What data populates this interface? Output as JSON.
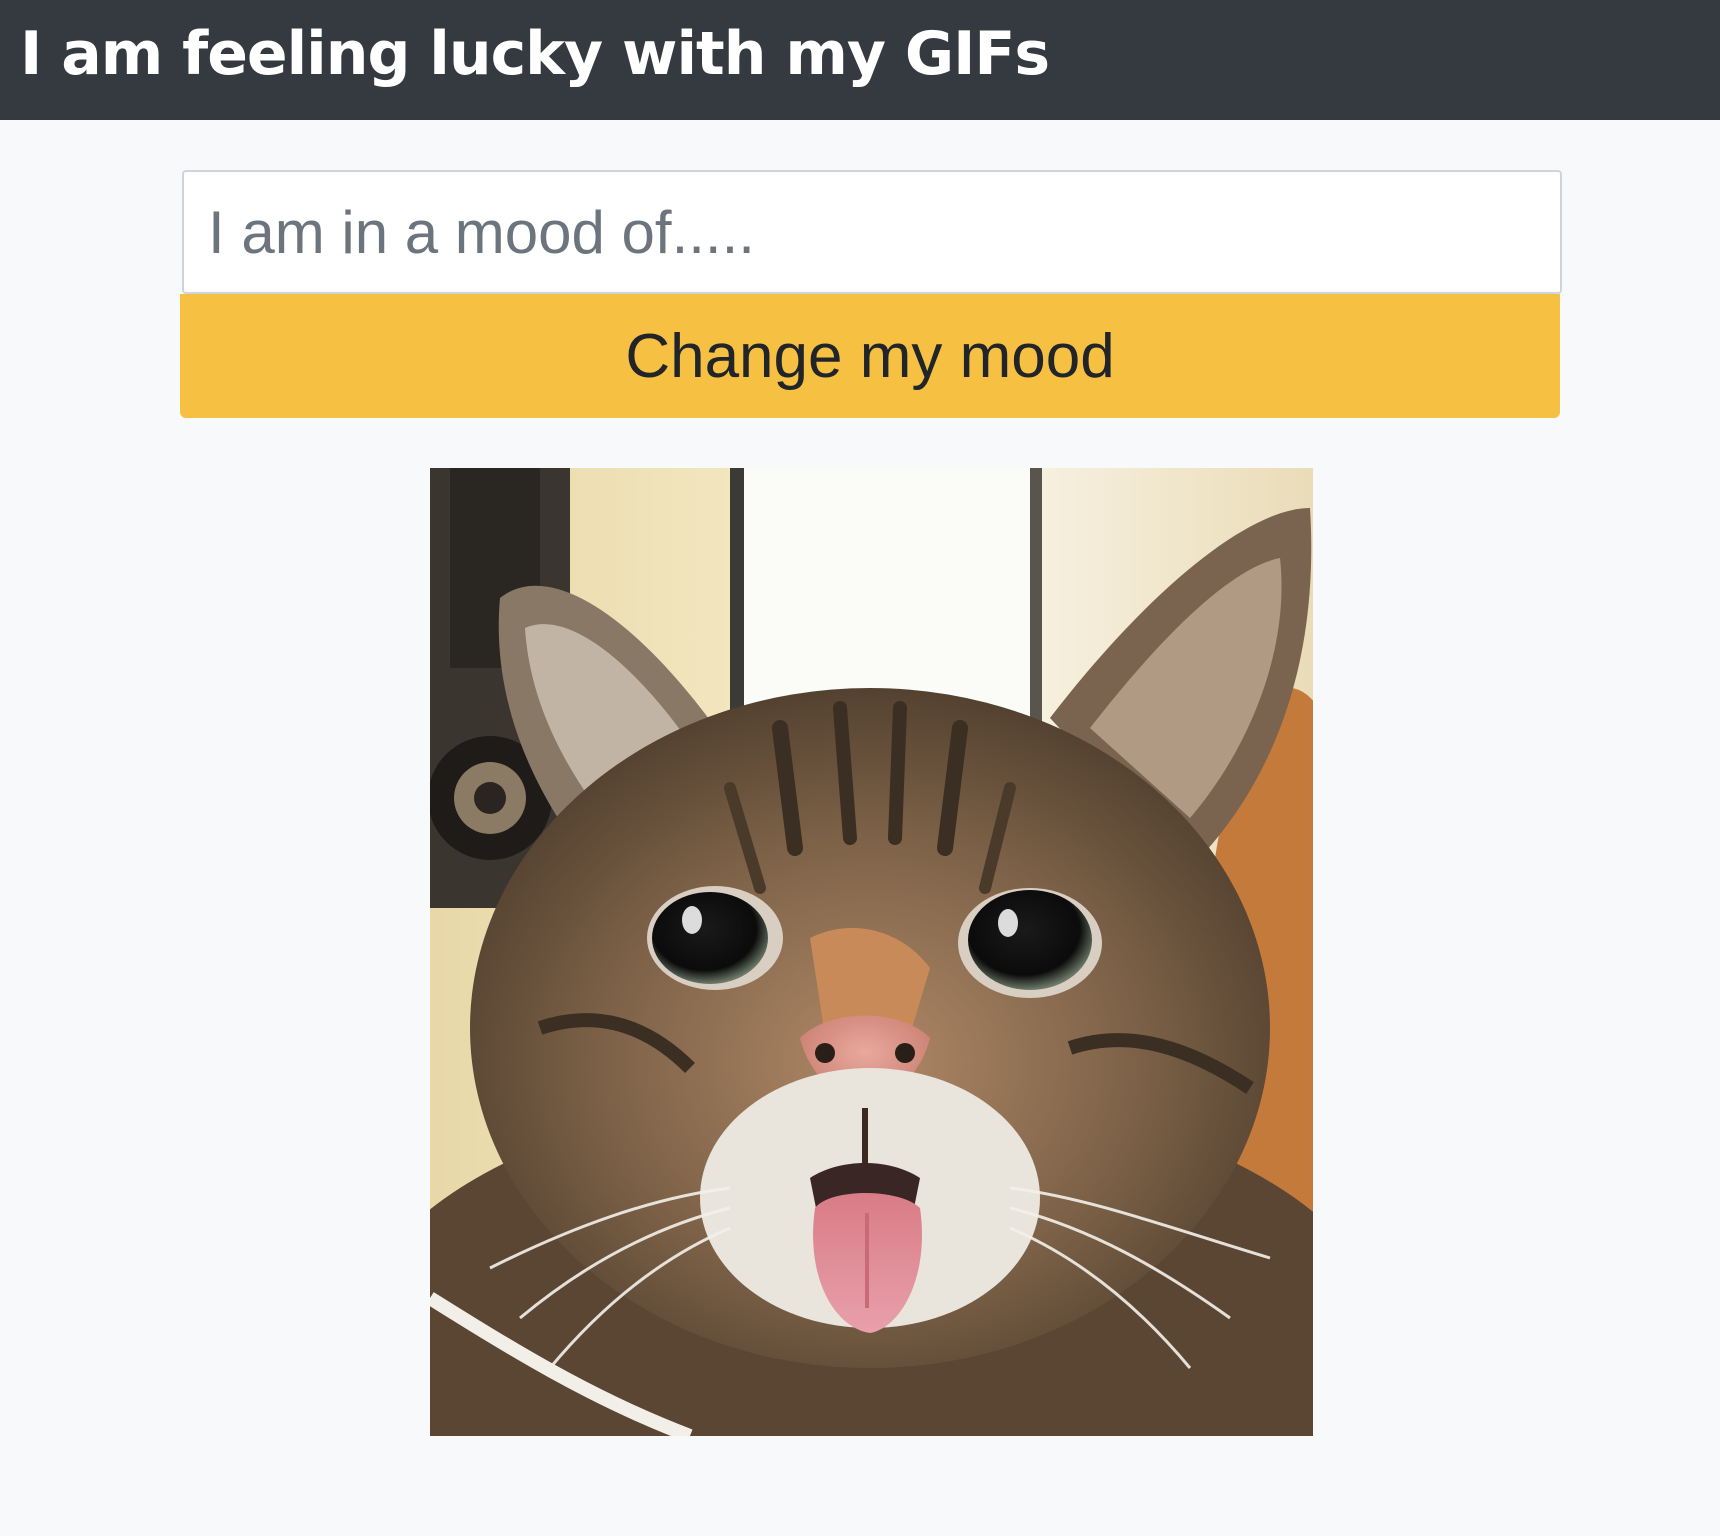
{
  "navbar": {
    "title": "I am feeling lucky with my GIFs",
    "background": "#343a40"
  },
  "search": {
    "placeholder": "I am in a mood of.....",
    "value": ""
  },
  "button": {
    "label": "Change my mood",
    "color": "#f6c142"
  },
  "gif": {
    "subject": "cat-with-tongue-out",
    "alt": ""
  },
  "colors": {
    "page_background": "#f8f9fa",
    "navbar_background": "#343a40",
    "button_background": "#f6c142"
  }
}
